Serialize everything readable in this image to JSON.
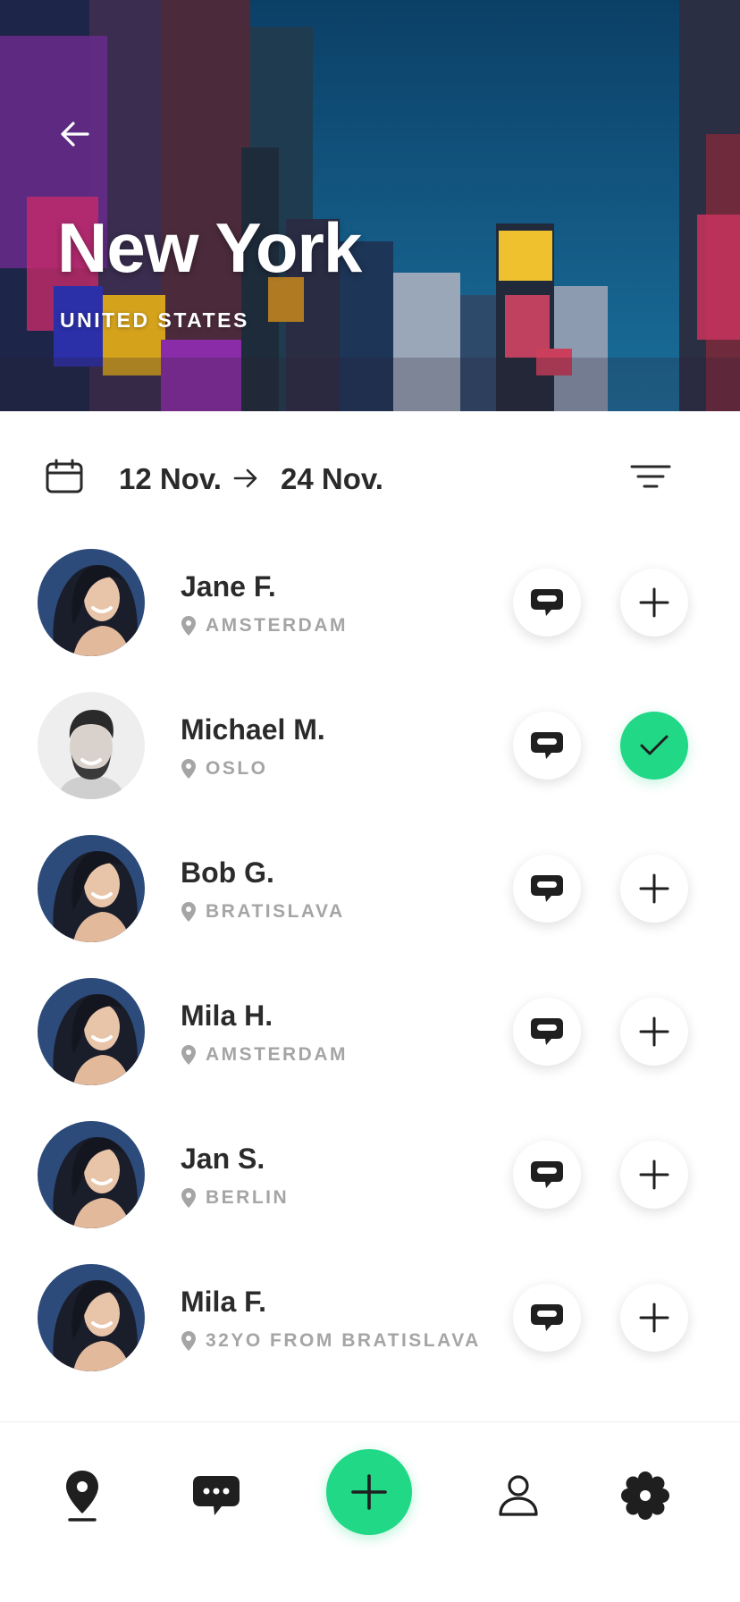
{
  "header": {
    "city": "New York",
    "country": "UNITED STATES",
    "back_icon": "arrow-left-icon"
  },
  "dates": {
    "from": "12 Nov.",
    "to": "24 Nov.",
    "calendar_icon": "calendar-icon",
    "filter_icon": "filter-icon"
  },
  "people": [
    {
      "name": "Jane F.",
      "location": "AMSTERDAM",
      "added": false,
      "avatar": "woman"
    },
    {
      "name": "Michael M.",
      "location": "OSLO",
      "added": true,
      "avatar": "man"
    },
    {
      "name": "Bob G.",
      "location": "BRATISLAVA",
      "added": false,
      "avatar": "woman"
    },
    {
      "name": "Mila H.",
      "location": "AMSTERDAM",
      "added": false,
      "avatar": "woman"
    },
    {
      "name": "Jan S.",
      "location": "BERLIN",
      "added": false,
      "avatar": "woman"
    },
    {
      "name": "Mila F.",
      "location": "32YO FROM BRATISLAVA",
      "added": false,
      "avatar": "woman"
    }
  ],
  "nav": {
    "items": [
      "map-pin-icon",
      "chat-icon",
      "plus-icon",
      "profile-icon",
      "settings-icon"
    ]
  },
  "colors": {
    "accent": "#21d887",
    "text": "#2b2b2b",
    "muted": "#a5a5a5"
  }
}
